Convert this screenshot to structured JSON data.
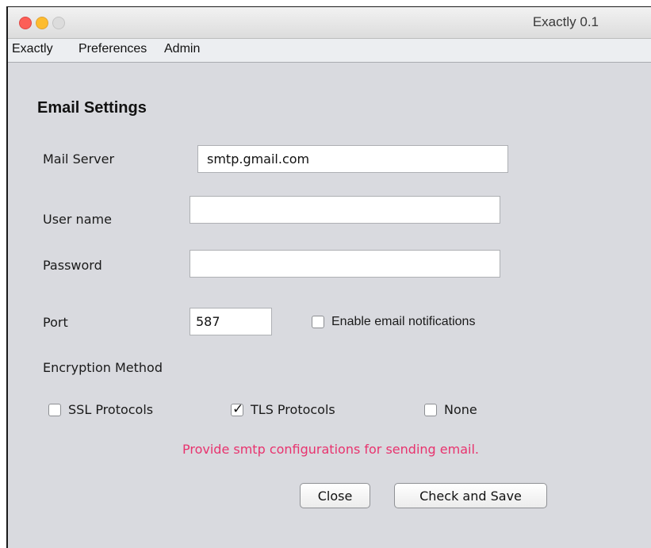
{
  "window": {
    "title": "Exactly 0.1"
  },
  "menubar": {
    "items": [
      "Exactly",
      "Preferences",
      "Admin"
    ]
  },
  "form": {
    "heading": "Email Settings",
    "mail_server": {
      "label": "Mail Server",
      "value": "smtp.gmail.com"
    },
    "username": {
      "label": "User name",
      "value": ""
    },
    "password": {
      "label": "Password",
      "value": ""
    },
    "port": {
      "label": "Port",
      "value": "587"
    },
    "enable_notifications": {
      "label": "Enable email notifications",
      "checked": false
    },
    "encryption": {
      "label": "Encryption Method",
      "options": [
        {
          "label": "SSL Protocols",
          "checked": false
        },
        {
          "label": "TLS Protocols",
          "checked": true
        },
        {
          "label": "None",
          "checked": false
        }
      ]
    },
    "message": "Provide smtp configurations for sending email.",
    "message_color": "#e8336e"
  },
  "buttons": {
    "close": "Close",
    "check_save": "Check and Save"
  },
  "icons": {
    "close_light": "close-icon",
    "minimize_light": "minimize-icon",
    "zoom_light": "zoom-icon",
    "checkmark": "checkmark-icon"
  }
}
